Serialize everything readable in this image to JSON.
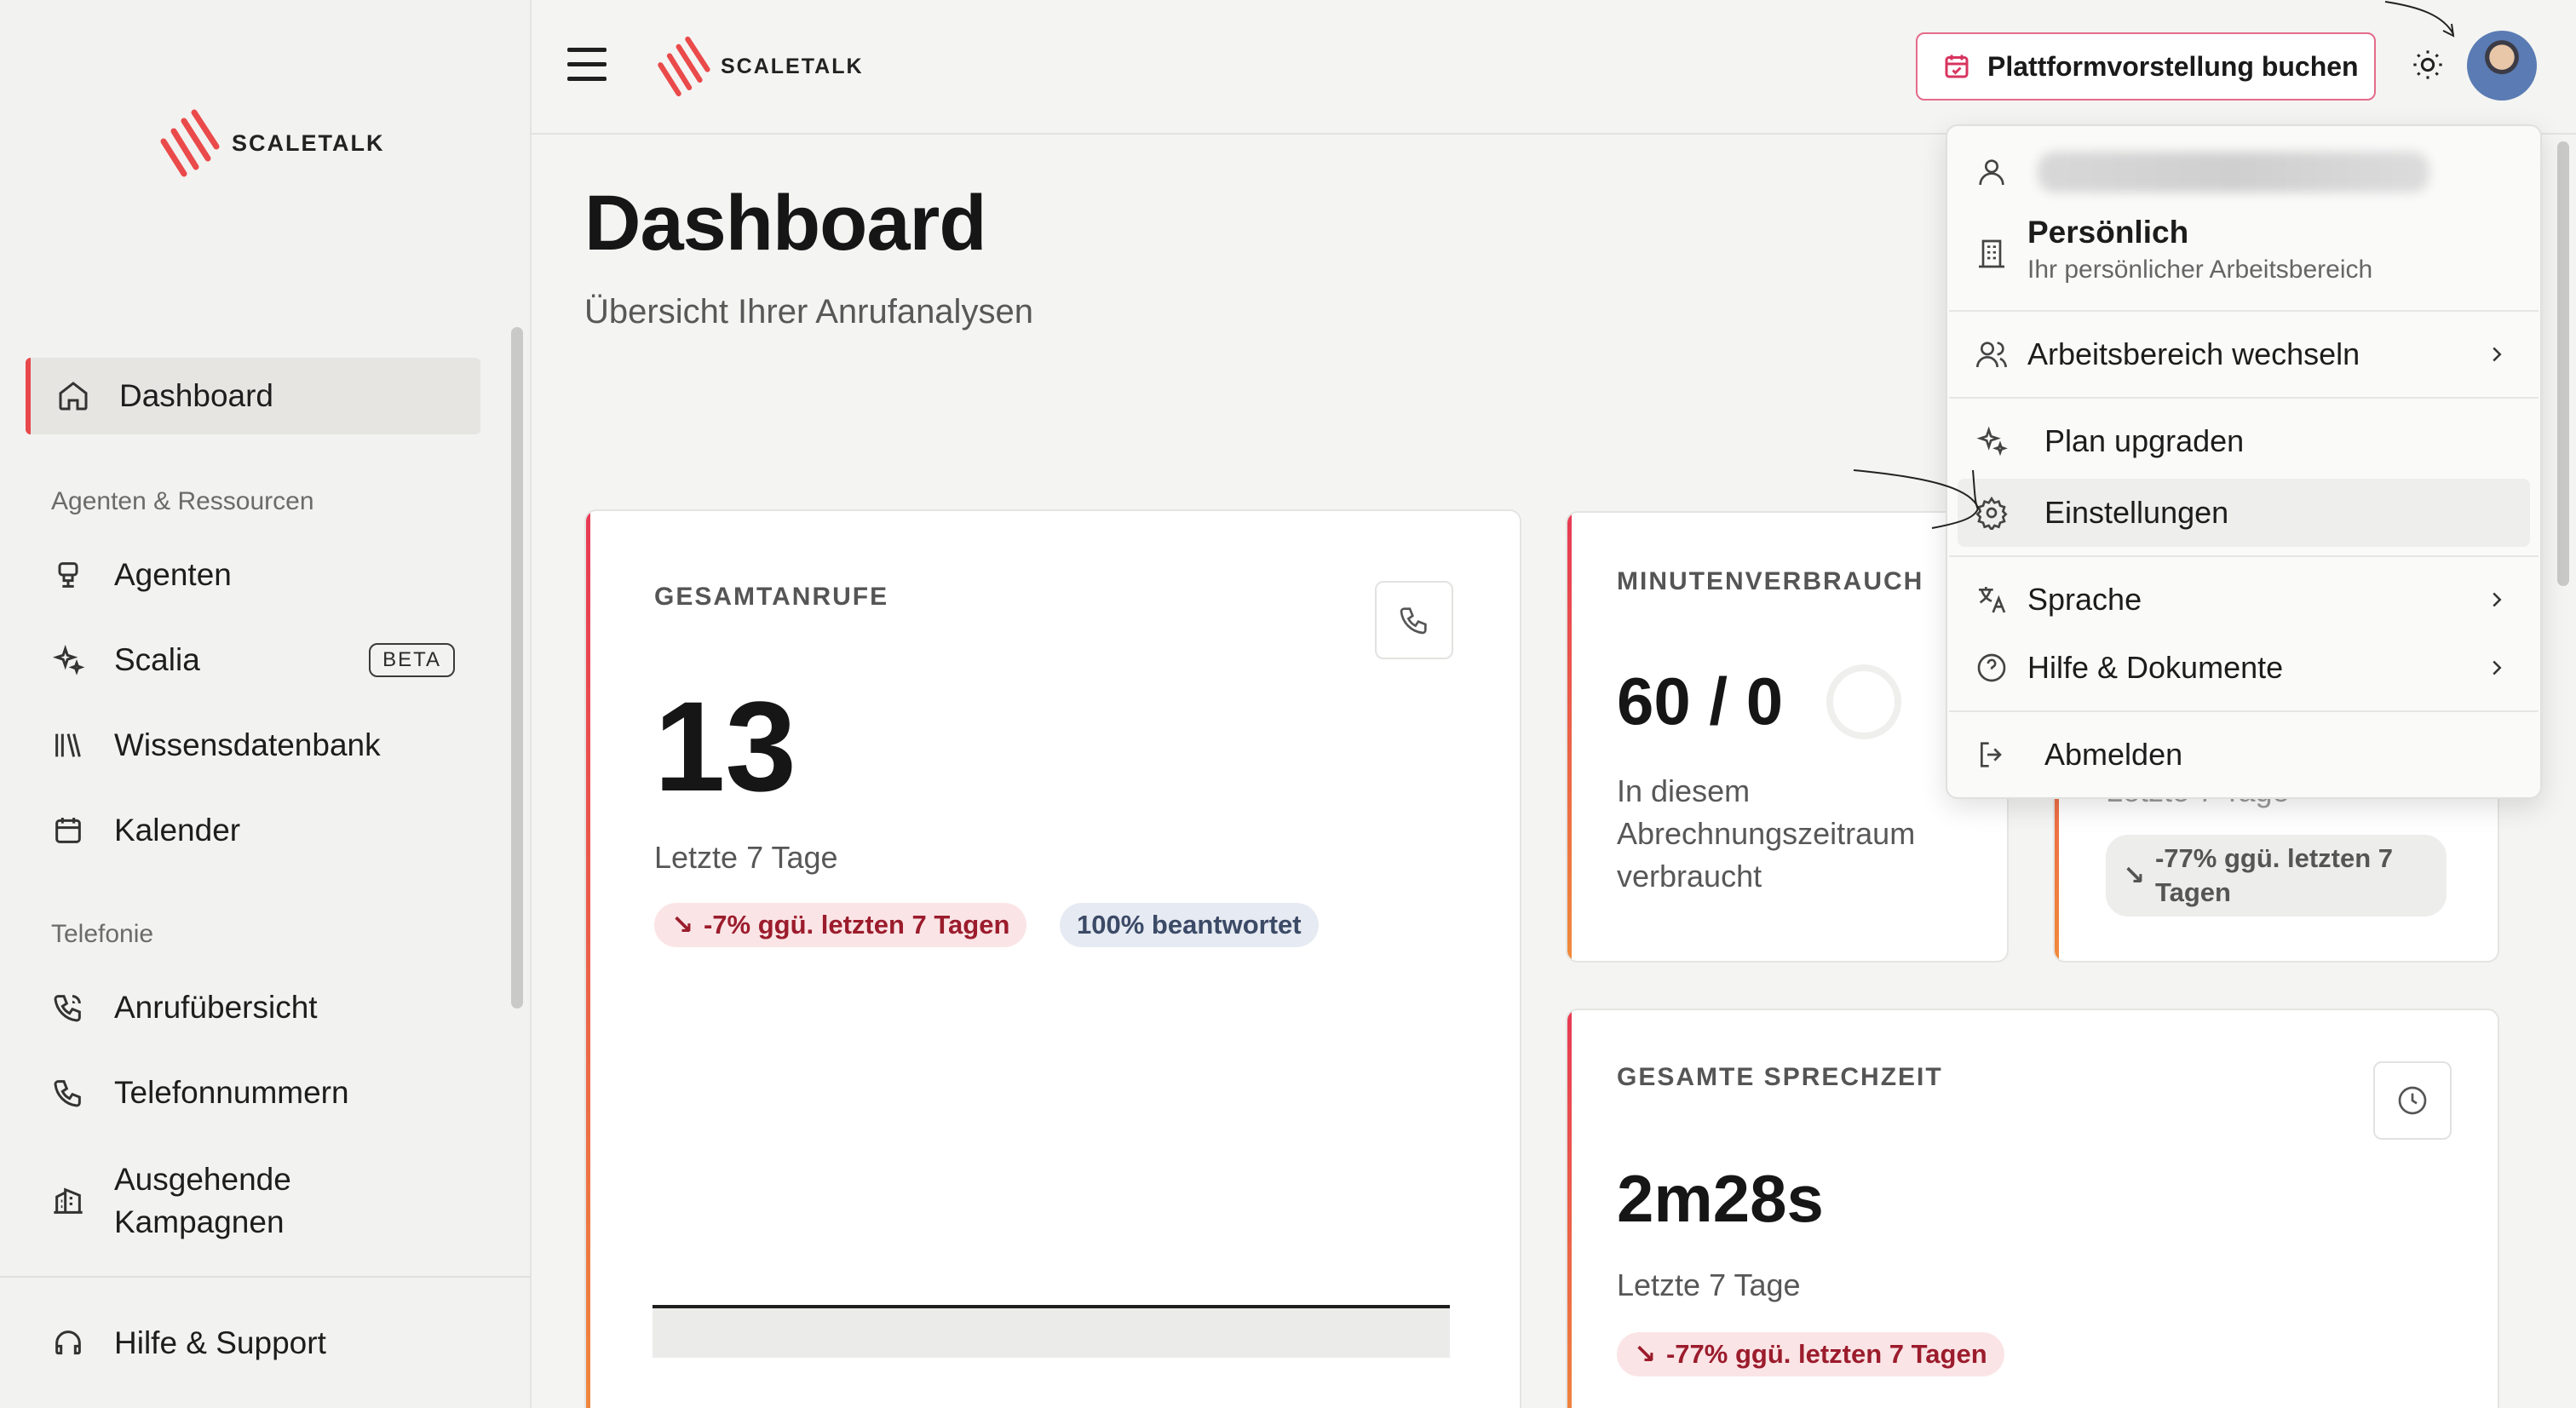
{
  "brand": {
    "name": "SCALETALK"
  },
  "sidebar": {
    "items": [
      {
        "label": "Dashboard",
        "icon": "home-icon"
      },
      {
        "label": "Agenten",
        "icon": "bot-icon"
      },
      {
        "label": "Scalia",
        "icon": "sparkles-icon",
        "badge": "BETA"
      },
      {
        "label": "Wissensdatenbank",
        "icon": "library-icon"
      },
      {
        "label": "Kalender",
        "icon": "calendar-icon"
      },
      {
        "label": "Anrufübersicht",
        "icon": "phone-list-icon"
      },
      {
        "label": "Telefonnummern",
        "icon": "phone-icon"
      },
      {
        "label": "Ausgehende Kampagnen",
        "icon": "building-icon"
      }
    ],
    "sections": {
      "resources": "Agenten & Ressourcen",
      "telephony": "Telefonie"
    },
    "footer": {
      "help": "Hilfe & Support"
    }
  },
  "topbar": {
    "book_button": "Plattformvorstellung buchen"
  },
  "page": {
    "title": "Dashboard",
    "subtitle": "Übersicht Ihrer Anrufanalysen"
  },
  "cards": {
    "total_calls": {
      "label": "GESAMTANRUFE",
      "value": "13",
      "period": "Letzte 7 Tage",
      "change": "-7% ggü. letzten 7 Tagen",
      "answered": "100% beantwortet"
    },
    "minutes": {
      "label": "MINUTENVERBRAUCH",
      "value": "60 / 0",
      "desc": "In diesem Abrechnungszeitraum verbraucht"
    },
    "hidden": {
      "period": "Letzte 7 Tage",
      "change": "-77% ggü. letzten 7 Tagen"
    },
    "talk_time": {
      "label": "GESAMTE SPRECHZEIT",
      "value": "2m28s",
      "period": "Letzte 7 Tage",
      "change": "-77% ggü. letzten 7 Tagen"
    }
  },
  "user_menu": {
    "workspace_name": "Persönlich",
    "workspace_desc": "Ihr persönlicher Arbeitsbereich",
    "switch_workspace": "Arbeitsbereich wechseln",
    "upgrade": "Plan upgraden",
    "settings": "Einstellungen",
    "language": "Sprache",
    "help": "Hilfe & Dokumente",
    "logout": "Abmelden"
  },
  "colors": {
    "accent_red": "#e8474b",
    "accent_orange": "#f08a3c",
    "pill_red_bg": "#fbe4e6",
    "pill_red_text": "#9b1c2c"
  }
}
